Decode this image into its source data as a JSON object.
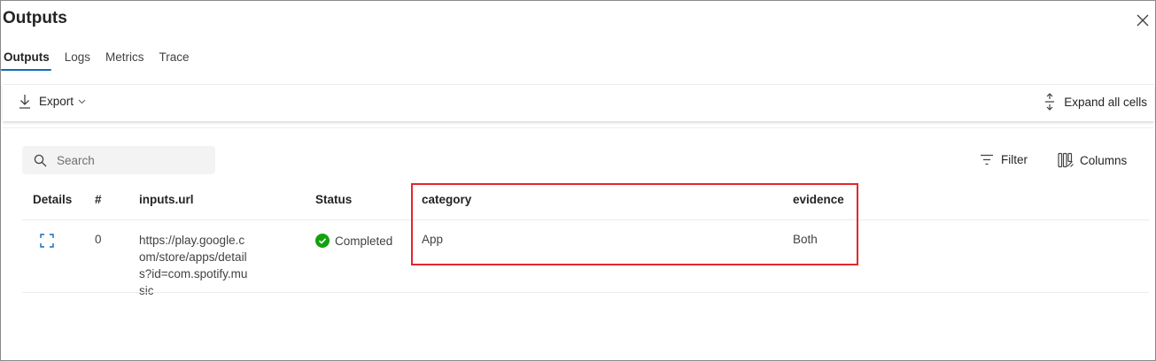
{
  "panel": {
    "title": "Outputs"
  },
  "tabs": [
    {
      "label": "Outputs",
      "active": true
    },
    {
      "label": "Logs",
      "active": false
    },
    {
      "label": "Metrics",
      "active": false
    },
    {
      "label": "Trace",
      "active": false
    }
  ],
  "toolbar": {
    "export_label": "Export",
    "expand_label": "Expand all cells"
  },
  "search": {
    "placeholder": "Search"
  },
  "actions": {
    "filter_label": "Filter",
    "columns_label": "Columns"
  },
  "table": {
    "headers": [
      "Details",
      "#",
      "inputs.url",
      "Status",
      "category",
      "evidence"
    ],
    "rows": [
      {
        "index": "0",
        "url": "https://play.google.com/store/apps/details?id=com.spotify.music",
        "status": "Completed",
        "category": "App",
        "evidence": "Both"
      }
    ]
  },
  "colors": {
    "accent": "#0f6cbd",
    "success": "#13a10e",
    "highlight": "#e3262d"
  }
}
